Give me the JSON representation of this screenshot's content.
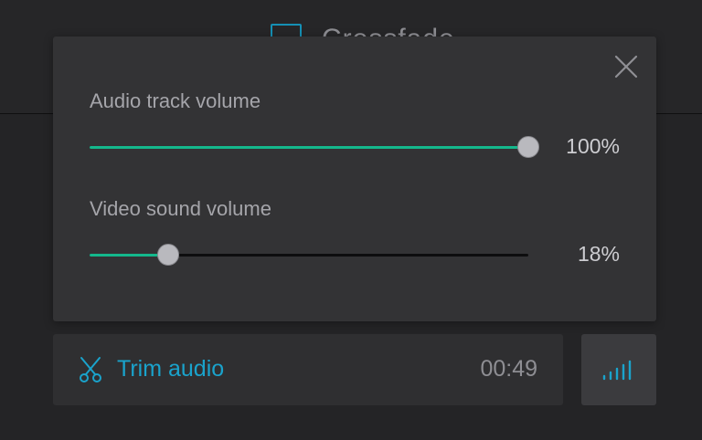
{
  "background": {
    "title": "Crossfade"
  },
  "dialog": {
    "close_icon": "close-icon",
    "audio_track": {
      "label": "Audio track volume",
      "value": 100,
      "value_text": "100%"
    },
    "video_sound": {
      "label": "Video sound volume",
      "value": 18,
      "value_text": "18%"
    }
  },
  "bottom_bar": {
    "trim_icon": "scissors-icon",
    "trim_label": "Trim audio",
    "duration": "00:49",
    "volume_icon": "volume-bars-icon"
  },
  "colors": {
    "accent_green": "#14b88c",
    "accent_blue": "#1aa3cc",
    "dialog_bg": "#333335",
    "page_bg": "#242426"
  }
}
